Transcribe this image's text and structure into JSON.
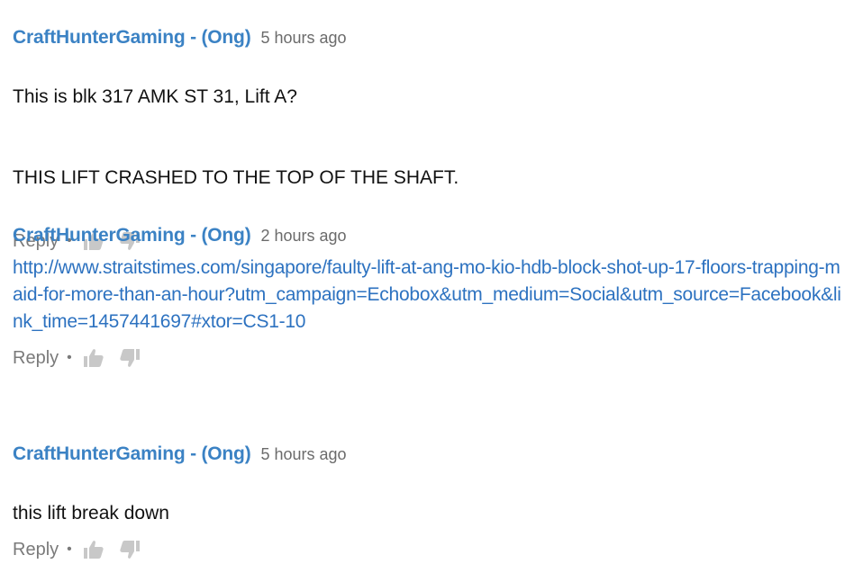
{
  "comments": [
    {
      "author": "CraftHunterGaming - (Ong)",
      "time": "5 hours ago",
      "lines": [
        "This is blk 317 AMK ST 31, Lift A?",
        "THIS LIFT CRASHED TO THE TOP OF THE SHAFT."
      ],
      "reply_label": "Reply",
      "separator": "•"
    },
    {
      "author": "CraftHunterGaming - (Ong)",
      "time": "2 hours ago",
      "link": "http://www.straitstimes.com/singapore/faulty-lift-at-ang-mo-kio-hdb-block-shot-up-17-floors-trapping-maid-for-more-than-an-hour?utm_campaign=Echobox&utm_medium=Social&utm_source=Facebook&link_time=1457441697#xtor=CS1-10",
      "reply_label": "Reply",
      "separator": "•"
    },
    {
      "author": "CraftHunterGaming - (Ong)",
      "time": "5 hours ago",
      "lines": [
        "this lift break down"
      ],
      "reply_label": "Reply",
      "separator": "•"
    }
  ],
  "icons": {
    "like": "thumbs-up-icon",
    "dislike": "thumbs-down-icon"
  },
  "colors": {
    "author": "#3b82c4",
    "link": "#2d72c0",
    "text": "#111111",
    "muted": "#7a7a7a",
    "icon": "#c8c8c8"
  }
}
